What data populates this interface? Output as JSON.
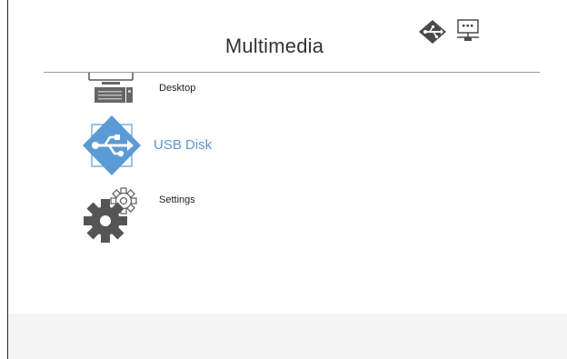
{
  "header": {
    "title": "Multimedia",
    "status_icons": [
      "usb-icon",
      "network-icon"
    ]
  },
  "menu": {
    "items": [
      {
        "label": "Desktop",
        "icon": "desktop-icon",
        "selected": false
      },
      {
        "label": "USB Disk",
        "icon": "usb-icon",
        "selected": true
      },
      {
        "label": "Settings",
        "icon": "gear-icon",
        "selected": false
      }
    ]
  },
  "colors": {
    "selected_text": "#5b97cf",
    "usb_diamond": "#5b9bd5",
    "icon_gray": "#555555",
    "divider": "#9a9a9a"
  }
}
